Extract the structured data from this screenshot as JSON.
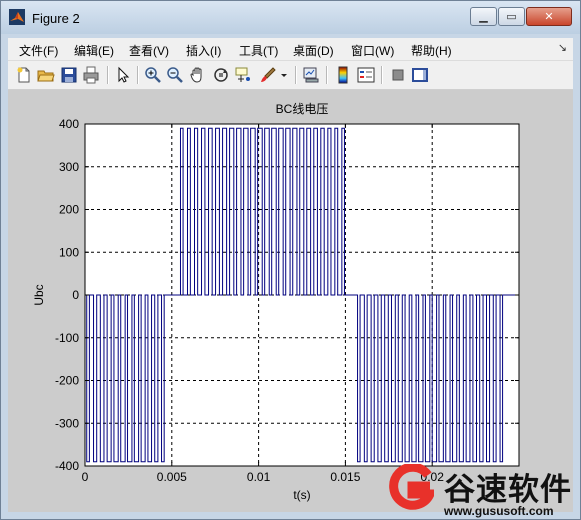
{
  "window": {
    "title": "Figure 2"
  },
  "menu": [
    "文件(F)",
    "编辑(E)",
    "查看(V)",
    "插入(I)",
    "工具(T)",
    "桌面(D)",
    "窗口(W)",
    "帮助(H)"
  ],
  "window_controls": {
    "minimize": "▁",
    "maximize": "▭",
    "close": "✕"
  },
  "toolbar_icons": [
    "new-figure-icon",
    "open-file-icon",
    "save-icon",
    "print-icon",
    "edit-plot-arrow-icon",
    "zoom-in-icon",
    "zoom-out-icon",
    "pan-hand-icon",
    "rotate-3d-icon",
    "data-cursor-icon",
    "brush-icon",
    "dropdown-arrow-icon",
    "link-plot-icon",
    "colorbar-icon",
    "legend-icon",
    "hide-plot-tools-icon",
    "show-plot-tools-icon"
  ],
  "chart_data": {
    "type": "line",
    "title": "BC线电压",
    "xlabel": "t(s)",
    "ylabel": "Ubc",
    "xlim": [
      0,
      0.025
    ],
    "ylim": [
      -400,
      400
    ],
    "xticks": [
      "0",
      "0.005",
      "0.01",
      "0.015",
      "0.02"
    ],
    "yticks": [
      "-400",
      "-300",
      "-200",
      "-100",
      "0",
      "100",
      "200",
      "300",
      "400"
    ],
    "grid": true,
    "line_color": "#00007f",
    "series": [
      {
        "amplitude": 390,
        "segments": [
          {
            "from": 0.0001,
            "to": 0.0048,
            "level": -390,
            "pulses": 12
          },
          {
            "from": 0.0055,
            "to": 0.0152,
            "level": 390,
            "pulses": 24
          },
          {
            "from": 0.0157,
            "to": 0.0243,
            "level": -390,
            "pulses": 22
          }
        ]
      }
    ]
  },
  "watermark": {
    "name": "谷速软件",
    "url": "www.gususoft.com"
  },
  "colors": {
    "accent": "#e8312a"
  }
}
